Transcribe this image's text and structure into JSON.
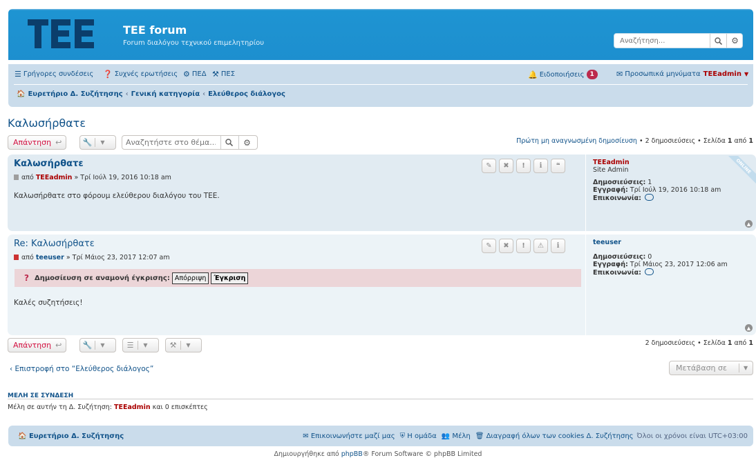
{
  "header": {
    "logo_text": "TEE",
    "title": "TEE forum",
    "description": "Forum διαλόγου τεχνικού επιμελητηρίου",
    "search_placeholder": "Αναζήτηση...",
    "brand_color": "#1d8fcf"
  },
  "nav": {
    "quick_links": "Γρήγορες συνδέσεις",
    "faq": "Συχνές ερωτήσεις",
    "acp": "ΠΕΔ",
    "mcp": "ΠΕΣ",
    "notifications": "Ειδοποιήσεις",
    "notifications_count": "1",
    "private_messages": "Προσωπικά μηνύματα",
    "username": "TEEadmin",
    "breadcrumbs": [
      "Ευρετήριο Δ. Συζήτησης",
      "Γενική κατηγορία",
      "Ελεύθερος διάλογος"
    ]
  },
  "topic": {
    "title": "Καλωσήρθατε",
    "reply_label": "Απάντηση",
    "search_placeholder": "Αναζητήστε στο θέμα...",
    "pagination_top": {
      "first_unread": "Πρώτη μη αναγνωσμένη δημοσίευση",
      "post_count": "2 δημοσιεύσεις",
      "page_prefix": "Σελίδα",
      "page_current": "1",
      "page_of": "από",
      "page_total": "1"
    }
  },
  "posts": [
    {
      "title": "Καλωσήρθατε",
      "by": "από",
      "author": "TEEadmin",
      "date": "» Τρί Ιούλ 19, 2016 10:18 am",
      "content": "Καλωσήρθατε στο φόρουμ ελεύθερου διαλόγου του ΤΕΕ.",
      "online_label": "ONLINE",
      "profile": {
        "username": "TEEadmin",
        "rank": "Site Admin",
        "posts_label": "Δημοσιεύσεις:",
        "posts": "1",
        "joined_label": "Εγγραφή:",
        "joined": "Τρί Ιούλ 19, 2016 10:18 am",
        "contact_label": "Επικοινωνία:"
      }
    },
    {
      "title": "Re: Καλωσήρθατε",
      "by": "από",
      "author": "teeuser",
      "date": "» Τρί Μάιος 23, 2017 12:07 am",
      "approval_label": "Δημοσίευση σε αναμονή έγκρισης:",
      "reject_label": "Απόρριψη",
      "approve_label": "Έγκριση",
      "content": "Καλές συζητήσεις!",
      "profile": {
        "username": "teeuser",
        "posts_label": "Δημοσιεύσεις:",
        "posts": "0",
        "joined_label": "Εγγραφή:",
        "joined": "Τρί Μάιος 23, 2017 12:06 am",
        "contact_label": "Επικοινωνία:"
      }
    }
  ],
  "bottom": {
    "pagination": {
      "post_count": "2 δημοσιεύσεις",
      "page_prefix": "Σελίδα",
      "page_current": "1",
      "page_of": "από",
      "page_total": "1"
    },
    "return_link": "Επιστροφή στο “Ελεύθερος διάλογος”",
    "jump_to": "Μετάβαση σε"
  },
  "online": {
    "heading": "ΜΕΛΗ ΣΕ ΣΥΝΔΕΣΗ",
    "prefix": "Μέλη σε αυτήν τη Δ. Συζήτηση:",
    "user": "TEEadmin",
    "suffix": "και 0 επισκέπτες"
  },
  "footer": {
    "home": "Ευρετήριο Δ. Συζήτησης",
    "contact": "Επικοινωνήστε μαζί μας",
    "team": "Η ομάδα",
    "members": "Μέλη",
    "delete_cookies": "Διαγραφή όλων των cookies Δ. Συζήτησης",
    "timezone": "Όλοι οι χρόνοι είναι UTC+03:00",
    "copyright_prefix": "Δημιουργήθηκε από",
    "copyright_brand": "phpBB",
    "copyright_suffix": "® Forum Software © phpBB Limited"
  }
}
